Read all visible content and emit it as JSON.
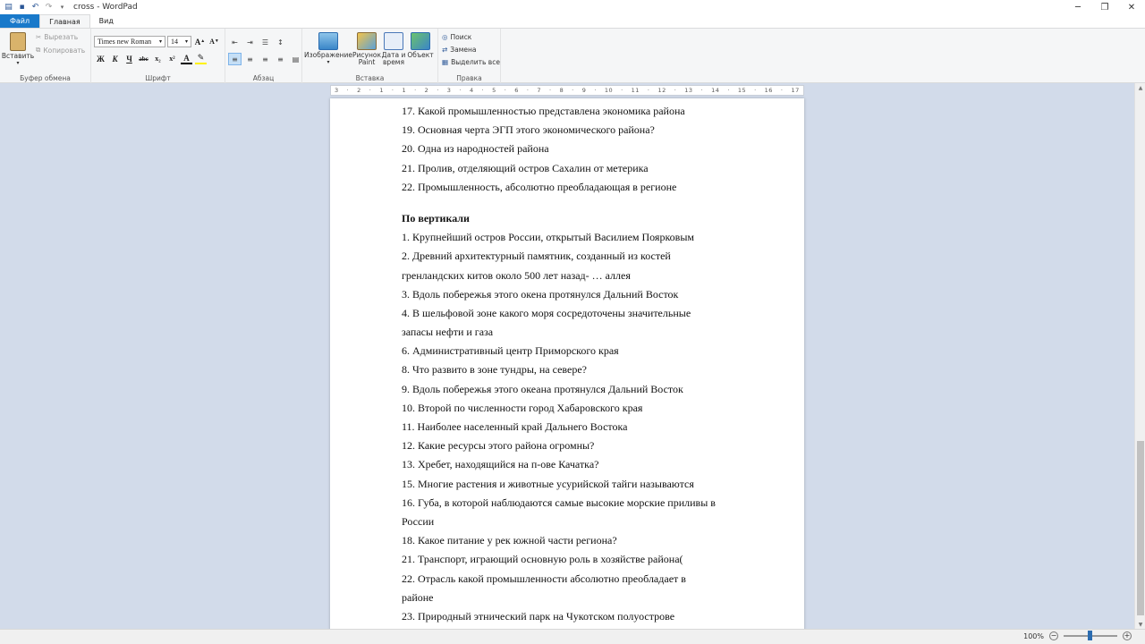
{
  "window": {
    "title": "cross - WordPad"
  },
  "tabs": {
    "file": "Файл",
    "home": "Главная",
    "view": "Вид"
  },
  "ribbon": {
    "clipboard": {
      "label": "Буфер обмена",
      "paste": "Вставить",
      "cut": "Вырезать",
      "copy": "Копировать"
    },
    "font": {
      "label": "Шрифт",
      "family": "Times new Roman",
      "size": "14",
      "bold": "Ж",
      "italic": "К",
      "underline": "Ч",
      "strike": "abc",
      "sub": "x₂",
      "sup": "x²"
    },
    "paragraph": {
      "label": "Абзац"
    },
    "insert": {
      "label": "Вставка",
      "picture": "Изображение",
      "paint_line1": "Рисунок",
      "paint_line2": "Paint",
      "datetime_line1": "Дата и",
      "datetime_line2": "время",
      "object": "Объект"
    },
    "editing": {
      "label": "Правка",
      "find": "Поиск",
      "replace": "Замена",
      "select_all": "Выделить все"
    }
  },
  "ruler": {
    "ticks": [
      "3",
      "·",
      "2",
      "·",
      "1",
      "·",
      "1",
      "·",
      "2",
      "·",
      "3",
      "·",
      "4",
      "·",
      "5",
      "·",
      "6",
      "·",
      "7",
      "·",
      "8",
      "·",
      "9",
      "·",
      "10",
      "·",
      "11",
      "·",
      "12",
      "·",
      "13",
      "·",
      "14",
      "·",
      "15",
      "·",
      "16",
      "·",
      "17"
    ]
  },
  "document": {
    "lines_top": [
      "17. Какой промышленностью представлена экономика района",
      "19. Основная черта ЭГП этого экономического района?",
      "20. Одна из народностей района",
      "21. Пролив, отделяющий остров Сахалин от метерика",
      "22. Промышленность, абсолютно преобладающая в регионе"
    ],
    "heading": "По вертикали",
    "lines_bottom": [
      "1. Крупнейший остров России, открытый Василием Поярковым",
      "2. Древний архитектурный памятник, созданный из костей",
      "гренландских китов около 500 лет назад- … аллея",
      "3. Вдоль побережья этого окена протянулся Дальний Восток",
      "4. В шельфовой зоне какого моря сосредоточены значительные",
      "запасы нефти и газа",
      "6. Административный центр Приморского края",
      "8. Что развито в зоне тундры, на севере?",
      "9. Вдоль побережья этого океана протянулся Дальний Восток",
      "10. Второй по численности город Хабаровского края",
      "11. Наиболее населенный край Дальнего Востока",
      "12. Какие ресурсы этого района огромны?",
      "13. Хребет, находящийся на п-ове Качатка?",
      "15. Многие растения и животные усурийской тайги называются",
      "16. Губа, в которой наблюдаются самые высокие морские приливы в",
      "России",
      "18. Какое питание у рек южной части региона?",
      "21. Транспорт, играющий основную роль в хозяйстве района(",
      "22. Отрасль какой промышленности абсолютно преобладает в",
      "районе",
      "23. Природный этнический парк на Чукотском полуострове"
    ]
  },
  "status": {
    "zoom": "100%"
  }
}
